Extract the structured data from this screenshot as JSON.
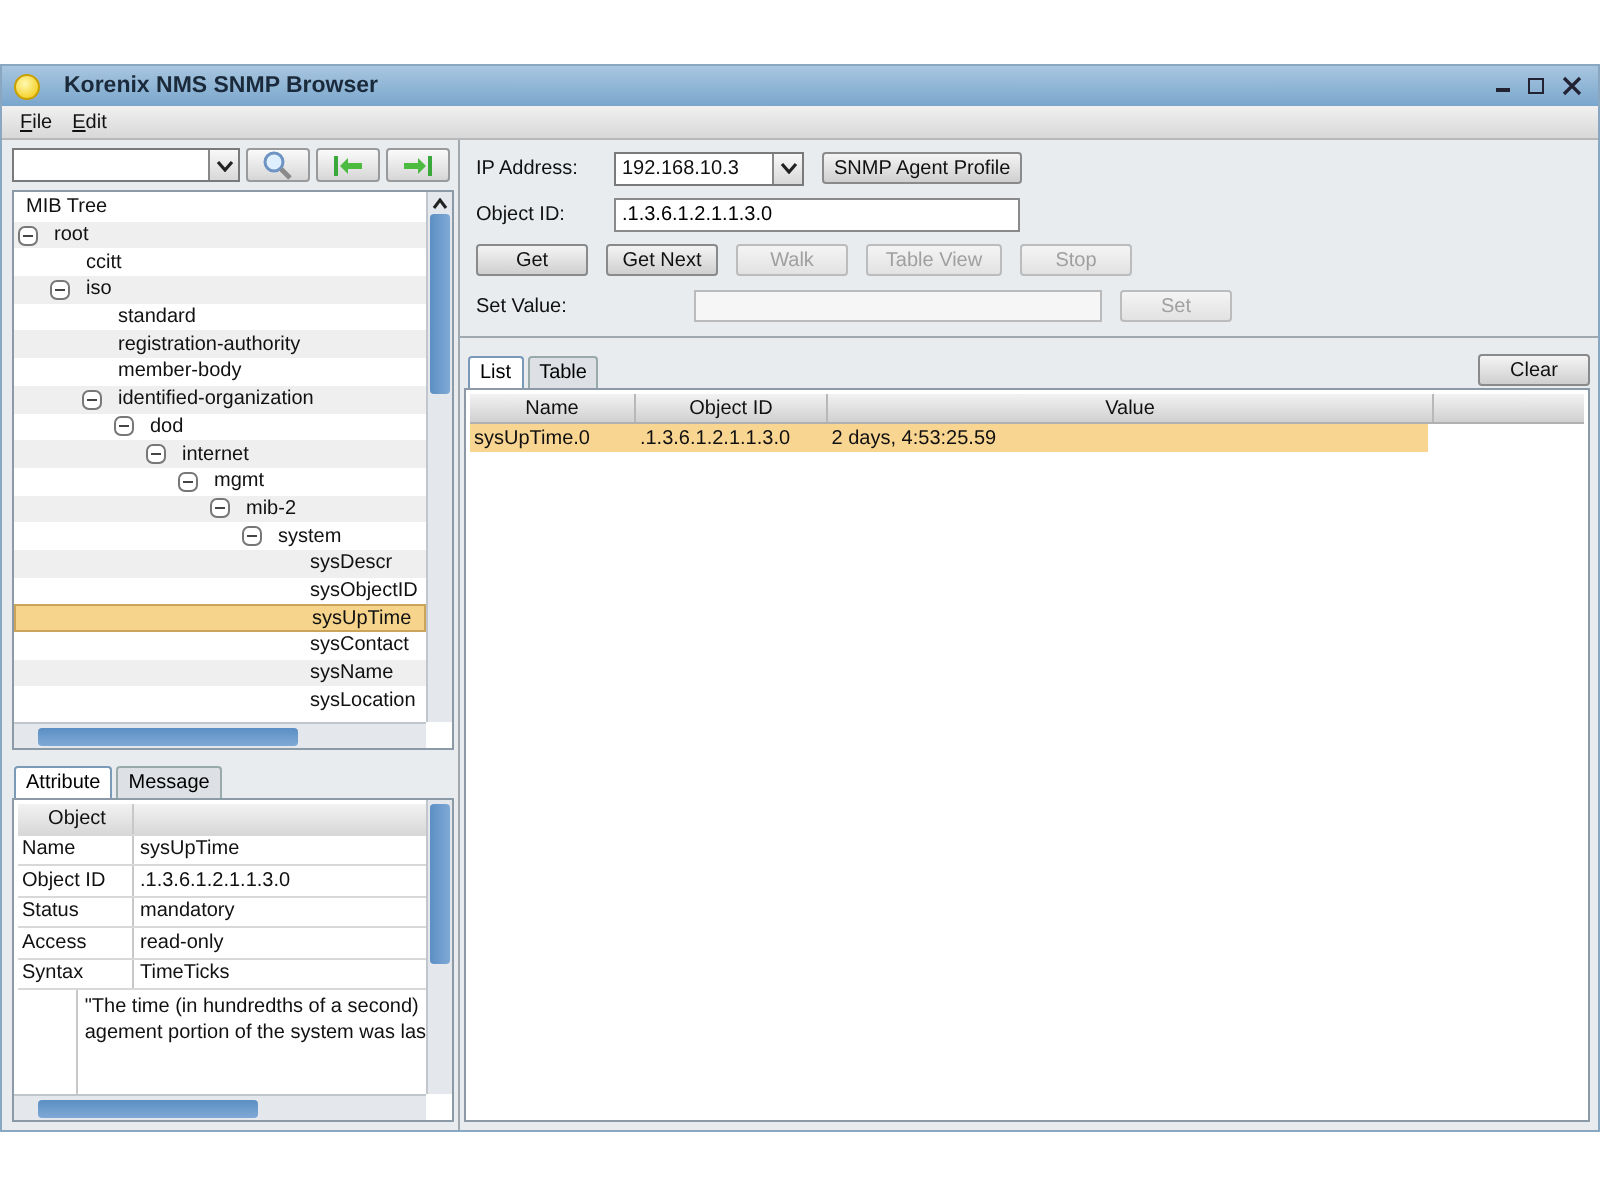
{
  "window": {
    "title": "Korenix NMS SNMP Browser"
  },
  "menu": [
    "File",
    "Edit"
  ],
  "mib_tree": {
    "title": "MIB Tree",
    "items": [
      {
        "label": "root",
        "expanded": true,
        "selected": false,
        "children": [
          {
            "label": "ccitt",
            "selected": false
          },
          {
            "label": "iso",
            "expanded": true,
            "selected": false,
            "children": [
              {
                "label": "standard",
                "selected": false
              },
              {
                "label": "registration-authority",
                "selected": false
              },
              {
                "label": "member-body",
                "selected": false
              },
              {
                "label": "identified-organization",
                "expanded": true,
                "selected": false,
                "children": [
                  {
                    "label": "dod",
                    "expanded": true,
                    "selected": false,
                    "children": [
                      {
                        "label": "internet",
                        "expanded": true,
                        "selected": false,
                        "children": [
                          {
                            "label": "mgmt",
                            "expanded": true,
                            "selected": false,
                            "children": [
                              {
                                "label": "mib-2",
                                "expanded": true,
                                "selected": false,
                                "children": [
                                  {
                                    "label": "system",
                                    "expanded": true,
                                    "selected": false,
                                    "children": [
                                      {
                                        "label": "sysDescr",
                                        "selected": false
                                      },
                                      {
                                        "label": "sysObjectID",
                                        "selected": false
                                      },
                                      {
                                        "label": "sysUpTime",
                                        "selected": true
                                      },
                                      {
                                        "label": "sysContact",
                                        "selected": false
                                      },
                                      {
                                        "label": "sysName",
                                        "selected": false
                                      },
                                      {
                                        "label": "sysLocation",
                                        "selected": false
                                      }
                                    ]
                                  }
                                ]
                              }
                            ]
                          }
                        ]
                      }
                    ]
                  }
                ]
              }
            ]
          }
        ]
      }
    ]
  },
  "attribute_panel": {
    "tabs": [
      {
        "label": "Attribute",
        "selected": true
      },
      {
        "label": "Message",
        "selected": false
      }
    ],
    "header": "Object",
    "rows": [
      {
        "name": "Name",
        "value": "sysUpTime"
      },
      {
        "name": "Object ID",
        "value": ".1.3.6.1.2.1.1.3.0"
      },
      {
        "name": "Status",
        "value": "mandatory"
      },
      {
        "name": "Access",
        "value": "read-only"
      },
      {
        "name": "Syntax",
        "value": "TimeTicks"
      }
    ],
    "description": [
      "\"The time (in hundredths of a second)",
      "agement portion of the system was las"
    ]
  },
  "query": {
    "ip_label": "IP Address:",
    "ip": "192.168.10.3",
    "profile_button": "SNMP Agent Profile",
    "oid_label": "Object ID:",
    "oid": ".1.3.6.1.2.1.1.3.0",
    "buttons": [
      {
        "label": "Get",
        "disabled": false
      },
      {
        "label": "Get Next",
        "disabled": false
      },
      {
        "label": "Walk",
        "disabled": true
      },
      {
        "label": "Table View",
        "disabled": true
      },
      {
        "label": "Stop",
        "disabled": true
      }
    ],
    "set_label": "Set Value:",
    "set_button": {
      "label": "Set",
      "disabled": true
    }
  },
  "results": {
    "tabs": [
      {
        "label": "List",
        "selected": true
      },
      {
        "label": "Table",
        "selected": false
      }
    ],
    "clear_button": "Clear",
    "columns": [
      "Name",
      "Object ID",
      "Value"
    ],
    "rows": [
      {
        "cells": [
          "sysUpTime.0",
          ".1.3.6.1.2.1.1.3.0",
          "2 days, 4:53:25.59"
        ],
        "selected": true
      }
    ]
  }
}
